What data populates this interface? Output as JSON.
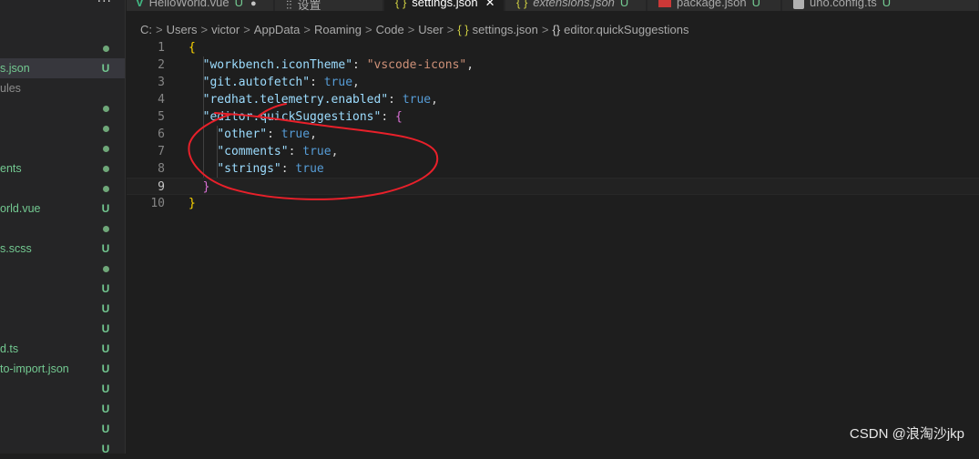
{
  "sidebar": {
    "more_label": "···",
    "rows": [
      {
        "name": "",
        "status": "dot",
        "color": "green"
      },
      {
        "name": "s.json",
        "status": "U",
        "color": "green",
        "selected": true
      },
      {
        "name": "ules",
        "status": "",
        "color": "grey"
      },
      {
        "name": "",
        "status": "dot",
        "color": "green"
      },
      {
        "name": "",
        "status": "dot",
        "color": "green"
      },
      {
        "name": "",
        "status": "dot",
        "color": "green"
      },
      {
        "name": "ents",
        "status": "dot",
        "color": "green"
      },
      {
        "name": "",
        "status": "dot",
        "color": "green"
      },
      {
        "name": "orld.vue",
        "status": "U",
        "color": "green"
      },
      {
        "name": "",
        "status": "dot",
        "color": "green"
      },
      {
        "name": "s.scss",
        "status": "U",
        "color": "green"
      },
      {
        "name": "",
        "status": "dot",
        "color": "green"
      },
      {
        "name": "",
        "status": "U",
        "color": "green"
      },
      {
        "name": "",
        "status": "U",
        "color": "green"
      },
      {
        "name": "",
        "status": "U",
        "color": "green"
      },
      {
        "name": "d.ts",
        "status": "U",
        "color": "green"
      },
      {
        "name": "to-import.json",
        "status": "U",
        "color": "green"
      },
      {
        "name": "",
        "status": "U",
        "color": "green"
      },
      {
        "name": "",
        "status": "U",
        "color": "green"
      },
      {
        "name": "",
        "status": "U",
        "color": "green"
      },
      {
        "name": "",
        "status": "U",
        "color": "green"
      }
    ]
  },
  "tabs": [
    {
      "label": "HelloWorld.vue",
      "icon": "vue-icon",
      "badge": "U",
      "modified": true
    },
    {
      "label": "设置",
      "icon": "settings-icon"
    },
    {
      "label": "settings.json",
      "icon": "json-icon",
      "active": true,
      "close": "✕"
    },
    {
      "label": "extensions.json",
      "icon": "json-icon",
      "badge": "U",
      "italic": true
    },
    {
      "label": "package.json",
      "icon": "npm-icon",
      "badge": "U"
    },
    {
      "label": "uno.config.ts",
      "icon": "uno-icon",
      "badge": "U"
    }
  ],
  "icons": {
    "json": "{ }",
    "vue": "V",
    "settings": "⫶⫶",
    "object": "{}"
  },
  "breadcrumb": [
    "C:",
    "Users",
    "victor",
    "AppData",
    "Roaming",
    "Code",
    "User",
    "settings.json",
    "editor.quickSuggestions"
  ],
  "breadcrumb_sep": ">",
  "editor": {
    "current_line": 9,
    "lines": [
      {
        "n": "1",
        "tokens": [
          [
            "brace",
            "{"
          ]
        ]
      },
      {
        "n": "2",
        "tokens": [
          [
            "punc",
            "  "
          ],
          [
            "key",
            "\"workbench.iconTheme\""
          ],
          [
            "punc",
            ": "
          ],
          [
            "str",
            "\"vscode-icons\""
          ],
          [
            "punc",
            ","
          ]
        ]
      },
      {
        "n": "3",
        "tokens": [
          [
            "punc",
            "  "
          ],
          [
            "key",
            "\"git.autofetch\""
          ],
          [
            "punc",
            ": "
          ],
          [
            "bool",
            "true"
          ],
          [
            "punc",
            ","
          ]
        ]
      },
      {
        "n": "4",
        "tokens": [
          [
            "punc",
            "  "
          ],
          [
            "key",
            "\"redhat.telemetry.enabled\""
          ],
          [
            "punc",
            ": "
          ],
          [
            "bool",
            "true"
          ],
          [
            "punc",
            ","
          ]
        ]
      },
      {
        "n": "5",
        "tokens": [
          [
            "punc",
            "  "
          ],
          [
            "key",
            "\"editor.quickSuggestions\""
          ],
          [
            "punc",
            ": "
          ],
          [
            "brace2",
            "{"
          ]
        ]
      },
      {
        "n": "6",
        "tokens": [
          [
            "punc",
            "    "
          ],
          [
            "key",
            "\"other\""
          ],
          [
            "punc",
            ": "
          ],
          [
            "bool",
            "true"
          ],
          [
            "punc",
            ","
          ]
        ]
      },
      {
        "n": "7",
        "tokens": [
          [
            "punc",
            "    "
          ],
          [
            "key",
            "\"comments\""
          ],
          [
            "punc",
            ": "
          ],
          [
            "bool",
            "true"
          ],
          [
            "punc",
            ","
          ]
        ]
      },
      {
        "n": "8",
        "tokens": [
          [
            "punc",
            "    "
          ],
          [
            "key",
            "\"strings\""
          ],
          [
            "punc",
            ": "
          ],
          [
            "bool",
            "true"
          ]
        ]
      },
      {
        "n": "9",
        "tokens": [
          [
            "punc",
            "  "
          ],
          [
            "brace2",
            "}"
          ]
        ]
      },
      {
        "n": "10",
        "tokens": [
          [
            "brace",
            "}"
          ]
        ]
      }
    ]
  },
  "colors": {
    "annotation": "#e8202a",
    "untracked": "#73c991",
    "key": "#9cdcfe",
    "string": "#ce9178",
    "boolean": "#569cd6"
  },
  "watermark": "CSDN @浪淘沙jkp"
}
